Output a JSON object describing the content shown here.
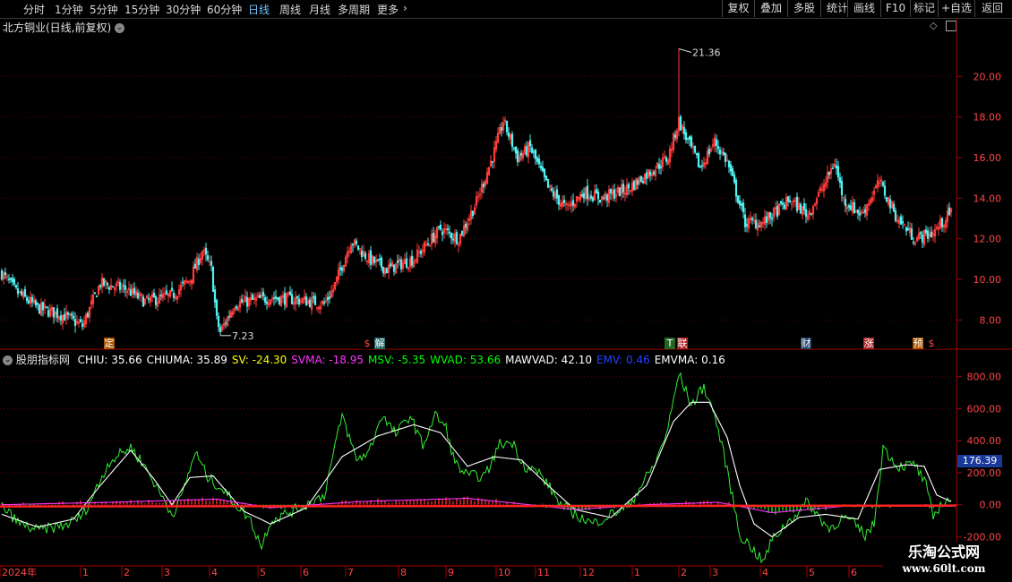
{
  "toolbar": {
    "periods": [
      "分时",
      "1分钟",
      "5分钟",
      "15分钟",
      "30分钟",
      "60分钟",
      "日线",
      "周线",
      "月线",
      "多周期",
      "更多"
    ],
    "active_period": "日线",
    "right_buttons": [
      "复权",
      "叠加",
      "多股",
      "统计",
      "画线",
      "F10",
      "+自选",
      "返回"
    ]
  },
  "main_panel": {
    "title": "北方铜业(日线,前复权)",
    "high_label": "21.36",
    "low_label": "7.23"
  },
  "indicator_panel": {
    "name": "股朋指标网",
    "values": [
      {
        "label": "CHIU: 35.66",
        "color": "#ffffff"
      },
      {
        "label": "CHIUMA: 35.89",
        "color": "#ffffff"
      },
      {
        "label": "SV: -24.30",
        "color": "#ffff00"
      },
      {
        "label": "SVMA: -18.95",
        "color": "#ff33ff"
      },
      {
        "label": "MSV: -5.35",
        "color": "#00ff00"
      },
      {
        "label": "WVAD: 53.66",
        "color": "#00ff00"
      },
      {
        "label": "MAWVAD: 42.10",
        "color": "#ffffff"
      },
      {
        "label": "EMV: 0.46",
        "color": "#2244ff"
      },
      {
        "label": "EMVMA: 0.16",
        "color": "#ffffff"
      }
    ],
    "current_value_box": "176.39"
  },
  "watermark": {
    "line1": "乐淘公式网",
    "line2": "www.60lt.com"
  },
  "chart_data": [
    {
      "type": "candlestick",
      "title": "北方铜业(日线,前复权)",
      "y_ticks": [
        8.0,
        10.0,
        12.0,
        14.0,
        16.0,
        18.0,
        20.0
      ],
      "ylim": [
        7.0,
        22.0
      ],
      "x_months": [
        "2024年",
        "1",
        "2",
        "3",
        "4",
        "5",
        "6",
        "7",
        "8",
        "9",
        "10",
        "11",
        "12",
        "1",
        "2",
        "3",
        "4",
        "5",
        "6"
      ],
      "close_anchors": [
        [
          0,
          10.3
        ],
        [
          8,
          9.4
        ],
        [
          20,
          8.6
        ],
        [
          35,
          8.2
        ],
        [
          45,
          7.7
        ],
        [
          55,
          9.8
        ],
        [
          70,
          9.5
        ],
        [
          80,
          8.9
        ],
        [
          95,
          9.2
        ],
        [
          105,
          10.0
        ],
        [
          112,
          11.4
        ],
        [
          117,
          10.5
        ],
        [
          120,
          8.0
        ],
        [
          122,
          7.4
        ],
        [
          130,
          8.8
        ],
        [
          150,
          9.1
        ],
        [
          165,
          9.0
        ],
        [
          180,
          8.8
        ],
        [
          185,
          9.5
        ],
        [
          195,
          11.9
        ],
        [
          205,
          11.0
        ],
        [
          215,
          10.5
        ],
        [
          230,
          11.0
        ],
        [
          245,
          12.5
        ],
        [
          255,
          12.0
        ],
        [
          265,
          13.8
        ],
        [
          275,
          16.3
        ],
        [
          280,
          17.8
        ],
        [
          288,
          16.0
        ],
        [
          295,
          16.5
        ],
        [
          305,
          14.5
        ],
        [
          315,
          13.5
        ],
        [
          325,
          14.3
        ],
        [
          335,
          14.0
        ],
        [
          350,
          14.5
        ],
        [
          365,
          15.5
        ],
        [
          372,
          16.0
        ],
        [
          378,
          17.8
        ],
        [
          383,
          16.8
        ],
        [
          390,
          15.5
        ],
        [
          398,
          16.8
        ],
        [
          405,
          15.8
        ],
        [
          415,
          12.8
        ],
        [
          425,
          12.8
        ],
        [
          440,
          13.9
        ],
        [
          450,
          13.2
        ],
        [
          460,
          14.8
        ],
        [
          465,
          15.8
        ],
        [
          470,
          13.9
        ],
        [
          480,
          13.2
        ],
        [
          490,
          14.8
        ],
        [
          500,
          13.0
        ],
        [
          510,
          12.0
        ],
        [
          520,
          12.3
        ],
        [
          530,
          13.3
        ]
      ],
      "high_point": {
        "value": 21.36,
        "label": "21.36"
      },
      "low_point": {
        "value": 7.23,
        "label": "7.23"
      },
      "event_markers": [
        "定",
        "$",
        "解",
        "$",
        "T",
        "联",
        "财",
        "涨",
        "预",
        "$"
      ]
    },
    {
      "type": "line",
      "title": "股朋指标网",
      "y_ticks": [
        -200.0,
        0.0,
        200.0,
        400.0,
        600.0,
        800.0
      ],
      "ylim": [
        -360,
        860
      ],
      "series": [
        {
          "name": "WVAD",
          "color": "#33ee33",
          "anchors": [
            [
              0,
              -10
            ],
            [
              10,
              -120
            ],
            [
              20,
              -160
            ],
            [
              35,
              -130
            ],
            [
              45,
              -70
            ],
            [
              52,
              80
            ],
            [
              60,
              270
            ],
            [
              72,
              360
            ],
            [
              80,
              240
            ],
            [
              88,
              80
            ],
            [
              95,
              -60
            ],
            [
              100,
              40
            ],
            [
              108,
              330
            ],
            [
              115,
              170
            ],
            [
              122,
              110
            ],
            [
              130,
              10
            ],
            [
              138,
              -80
            ],
            [
              145,
              -260
            ],
            [
              150,
              -100
            ],
            [
              160,
              -50
            ],
            [
              170,
              0
            ],
            [
              180,
              60
            ],
            [
              190,
              560
            ],
            [
              198,
              280
            ],
            [
              205,
              330
            ],
            [
              212,
              560
            ],
            [
              220,
              440
            ],
            [
              228,
              560
            ],
            [
              235,
              370
            ],
            [
              242,
              560
            ],
            [
              248,
              480
            ],
            [
              253,
              260
            ],
            [
              260,
              180
            ],
            [
              270,
              180
            ],
            [
              278,
              380
            ],
            [
              285,
              390
            ],
            [
              292,
              240
            ],
            [
              300,
              200
            ],
            [
              307,
              90
            ],
            [
              312,
              0
            ],
            [
              320,
              -60
            ],
            [
              330,
              -120
            ],
            [
              340,
              -60
            ],
            [
              350,
              -10
            ],
            [
              357,
              120
            ],
            [
              365,
              260
            ],
            [
              372,
              480
            ],
            [
              378,
              820
            ],
            [
              385,
              620
            ],
            [
              392,
              740
            ],
            [
              398,
              560
            ],
            [
              405,
              220
            ],
            [
              412,
              -190
            ],
            [
              418,
              -260
            ],
            [
              425,
              -360
            ],
            [
              430,
              -220
            ],
            [
              438,
              -120
            ],
            [
              445,
              -40
            ],
            [
              450,
              20
            ],
            [
              455,
              -60
            ],
            [
              462,
              -150
            ],
            [
              470,
              -80
            ],
            [
              476,
              -120
            ],
            [
              482,
              -190
            ],
            [
              487,
              -120
            ],
            [
              492,
              360
            ],
            [
              500,
              240
            ],
            [
              510,
              250
            ],
            [
              516,
              120
            ],
            [
              520,
              -80
            ],
            [
              524,
              0
            ],
            [
              530,
              40
            ]
          ]
        },
        {
          "name": "MAWVAD",
          "color": "#ffffff",
          "anchors": [
            [
              0,
              -60
            ],
            [
              20,
              -140
            ],
            [
              40,
              -90
            ],
            [
              55,
              120
            ],
            [
              72,
              340
            ],
            [
              85,
              160
            ],
            [
              95,
              0
            ],
            [
              105,
              170
            ],
            [
              118,
              180
            ],
            [
              135,
              -40
            ],
            [
              150,
              -120
            ],
            [
              170,
              -20
            ],
            [
              190,
              300
            ],
            [
              210,
              430
            ],
            [
              230,
              500
            ],
            [
              245,
              450
            ],
            [
              260,
              240
            ],
            [
              275,
              300
            ],
            [
              290,
              280
            ],
            [
              305,
              120
            ],
            [
              320,
              -30
            ],
            [
              340,
              -80
            ],
            [
              360,
              120
            ],
            [
              375,
              520
            ],
            [
              385,
              640
            ],
            [
              395,
              640
            ],
            [
              405,
              420
            ],
            [
              412,
              120
            ],
            [
              420,
              -120
            ],
            [
              430,
              -200
            ],
            [
              445,
              -80
            ],
            [
              460,
              -60
            ],
            [
              478,
              -90
            ],
            [
              490,
              220
            ],
            [
              505,
              250
            ],
            [
              515,
              240
            ],
            [
              522,
              60
            ],
            [
              530,
              20
            ]
          ]
        },
        {
          "name": "SVMA",
          "color": "#ff33ff",
          "anchors": [
            [
              0,
              0
            ],
            [
              60,
              15
            ],
            [
              120,
              35
            ],
            [
              150,
              -20
            ],
            [
              200,
              20
            ],
            [
              260,
              40
            ],
            [
              320,
              -30
            ],
            [
              360,
              0
            ],
            [
              400,
              15
            ],
            [
              430,
              -50
            ],
            [
              470,
              -10
            ],
            [
              530,
              -10
            ]
          ]
        }
      ]
    }
  ]
}
